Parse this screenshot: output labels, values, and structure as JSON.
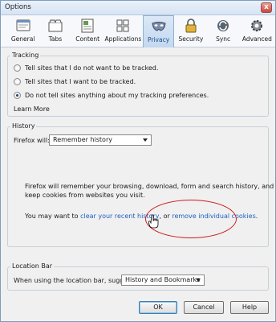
{
  "window": {
    "title": "Options",
    "close_label": "x"
  },
  "toolbar": {
    "items": [
      {
        "label": "General",
        "icon": "general-icon",
        "selected": false
      },
      {
        "label": "Tabs",
        "icon": "tabs-icon",
        "selected": false
      },
      {
        "label": "Content",
        "icon": "content-icon",
        "selected": false
      },
      {
        "label": "Applications",
        "icon": "applications-icon",
        "selected": false
      },
      {
        "label": "Privacy",
        "icon": "privacy-mask-icon",
        "selected": true
      },
      {
        "label": "Security",
        "icon": "security-lock-icon",
        "selected": false
      },
      {
        "label": "Sync",
        "icon": "sync-icon",
        "selected": false
      },
      {
        "label": "Advanced",
        "icon": "advanced-gear-icon",
        "selected": false
      }
    ]
  },
  "tracking": {
    "title": "Tracking",
    "options": [
      {
        "label": "Tell sites that I do not want to be tracked.",
        "checked": false
      },
      {
        "label": "Tell sites that I want to be tracked.",
        "checked": false
      },
      {
        "label": "Do not tell sites anything about my tracking preferences.",
        "checked": true
      }
    ],
    "learn_more": "Learn More"
  },
  "history": {
    "title": "History",
    "firefox_will_label": "Firefox will:",
    "mode_value": "Remember history",
    "description_line1": "Firefox will remember your browsing, download, form and search history, and",
    "description_line2": "keep cookies from websites you visit.",
    "may_want_prefix": "You may want to ",
    "clear_link": "clear your recent history",
    "separator": ", or ",
    "remove_cookies_link": "remove individual cookies",
    "suffix": "."
  },
  "location_bar": {
    "title": "Location Bar",
    "suggest_label": "When using the location bar, suggest:",
    "suggest_value": "History and Bookmarks"
  },
  "buttons": {
    "ok": "OK",
    "cancel": "Cancel",
    "help": "Help"
  }
}
